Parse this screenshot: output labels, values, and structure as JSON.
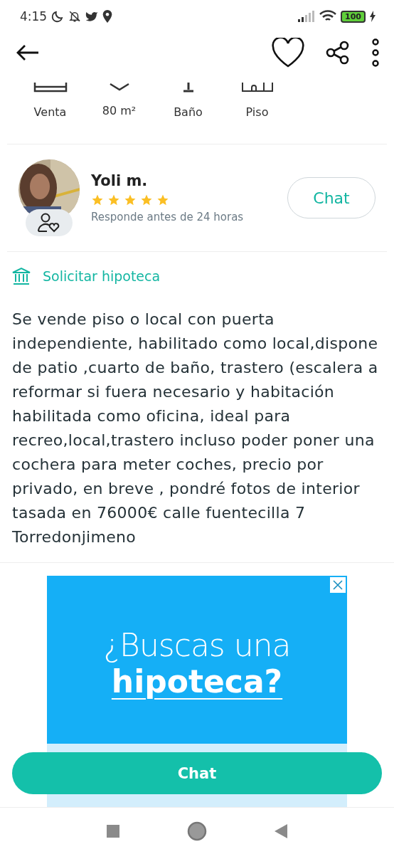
{
  "status_bar": {
    "time": "4:15",
    "battery": "100"
  },
  "features": [
    {
      "kind": "sale",
      "label": "Venta"
    },
    {
      "kind": "area",
      "label": "80 m²"
    },
    {
      "kind": "bath",
      "label": "Baño"
    },
    {
      "kind": "flat",
      "label": "Piso"
    }
  ],
  "seller": {
    "name": "Yoli m.",
    "stars": 5,
    "response": "Responde antes de 24 horas",
    "chat_button": "Chat"
  },
  "mortgage_link": "Solicitar hipoteca",
  "description": "Se vende piso o local con puerta independiente, habilitado como local,dispone de patio ,cuarto de baño, trastero (escalera a reformar si fuera necesario y habitación habilitada como oficina, ideal para recreo,local,trastero incluso poder poner una cochera para meter coches, precio por privado, en breve , pondré fotos de interior tasada en 76000€ calle fuentecilla 7 Torredonjimeno",
  "ad": {
    "line_1": "¿Buscas una",
    "line_2": "hipoteca?"
  },
  "chat_button": "Chat"
}
